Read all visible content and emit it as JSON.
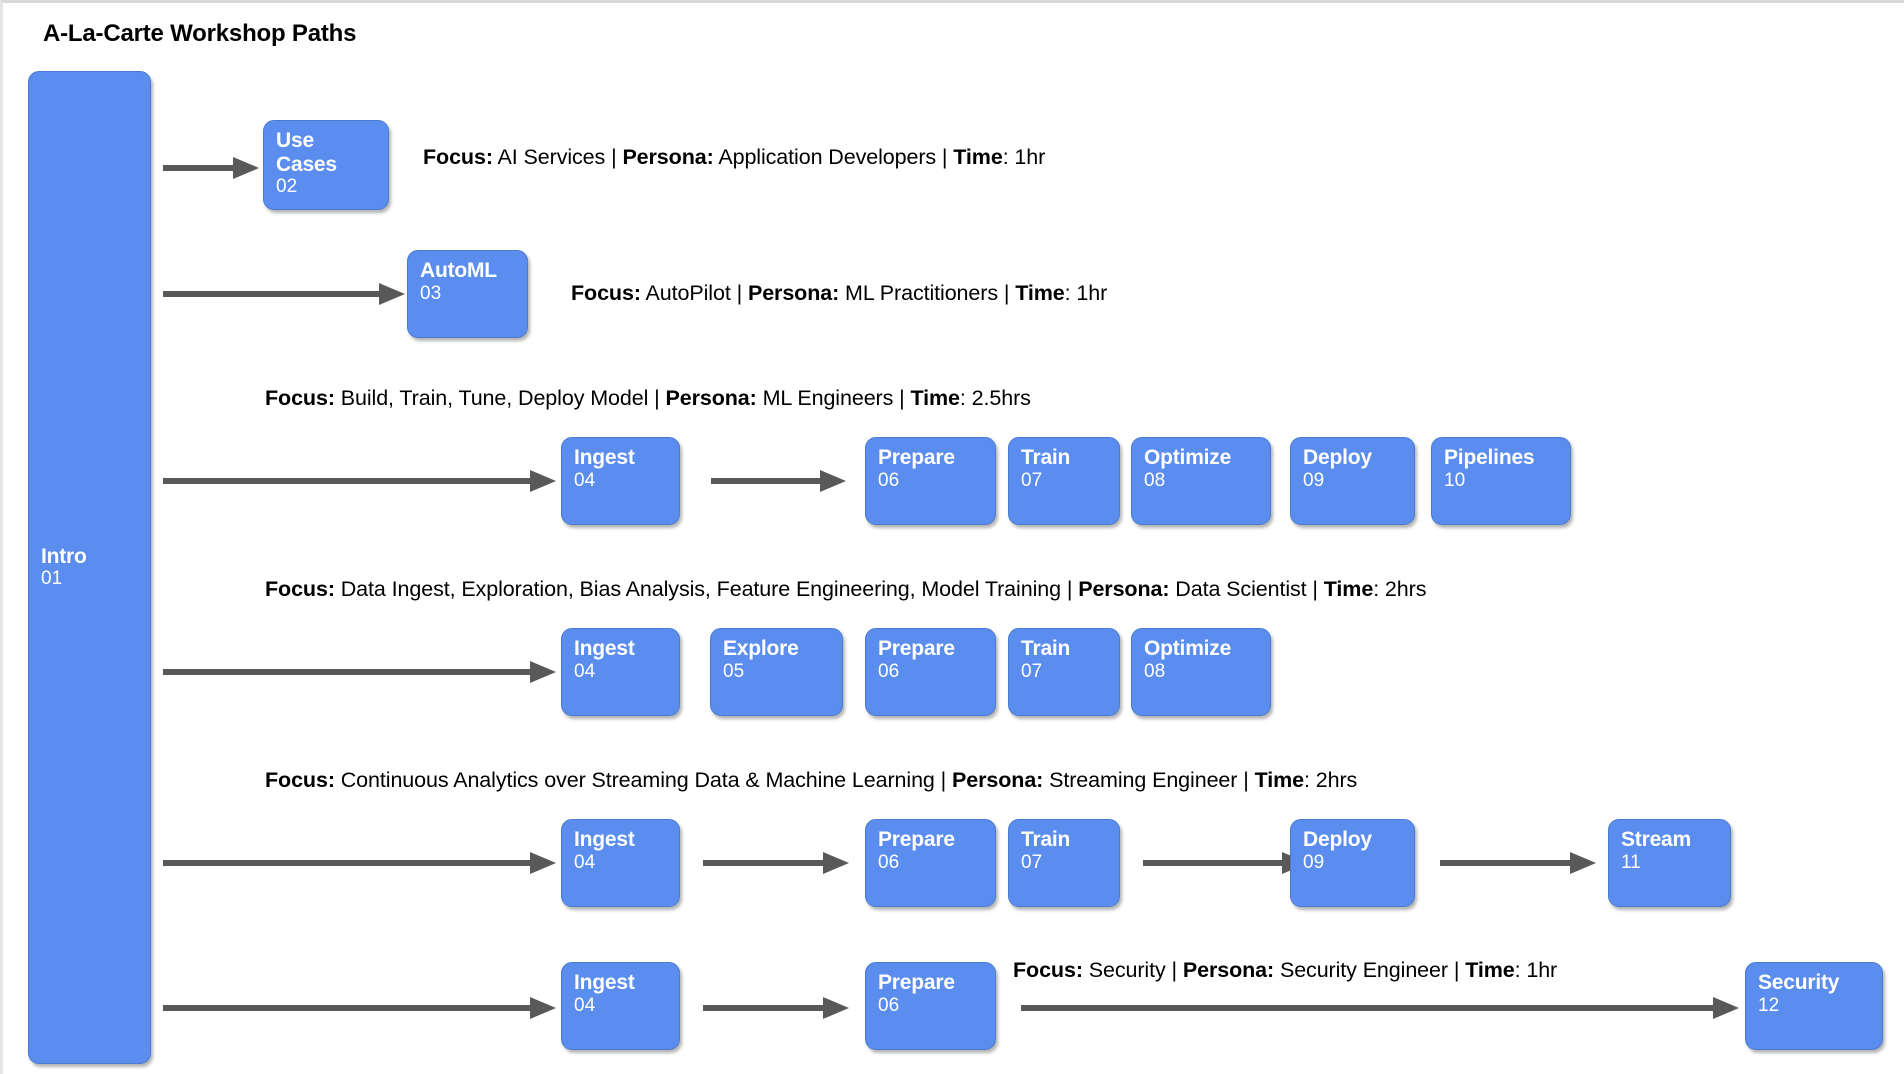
{
  "title": "A-La-Carte Workshop Paths",
  "theme": {
    "node_fill": "#5b8def",
    "node_border": "#4a7bd0",
    "node_text": "#ffffff",
    "arrow_color": "#595959",
    "background": "#ffffff",
    "caption_text": "#000000"
  },
  "intro": {
    "label": "Intro",
    "num": "01"
  },
  "rows": [
    {
      "id": "use-cases",
      "caption": {
        "focus_label": "Focus:",
        "focus": " AI Services | ",
        "persona_label": "Persona:",
        "persona": " Application Developers | ",
        "time_label": "Time",
        "time": ": 1hr"
      },
      "nodes": [
        {
          "label": "Use Cases",
          "line1": "Use",
          "line2": "Cases",
          "num": "02"
        }
      ]
    },
    {
      "id": "automl",
      "caption": {
        "focus_label": "Focus:",
        "focus": " AutoPilot | ",
        "persona_label": "Persona:",
        "persona": " ML Practitioners | ",
        "time_label": "Time",
        "time": ": 1hr"
      },
      "nodes": [
        {
          "label": "AutoML",
          "num": "03"
        }
      ]
    },
    {
      "id": "ml-engineers",
      "caption": {
        "focus_label": "Focus:",
        "focus": " Build, Train, Tune, Deploy Model  | ",
        "persona_label": "Persona:",
        "persona": " ML Engineers | ",
        "time_label": "Time",
        "time": ": 2.5hrs"
      },
      "nodes": [
        {
          "label": "Ingest",
          "num": "04"
        },
        {
          "label": "Prepare",
          "num": "06"
        },
        {
          "label": "Train",
          "num": "07"
        },
        {
          "label": "Optimize",
          "num": "08"
        },
        {
          "label": "Deploy",
          "num": "09"
        },
        {
          "label": "Pipelines",
          "num": "10"
        }
      ]
    },
    {
      "id": "data-scientist",
      "caption": {
        "focus_label": "Focus:",
        "focus": " Data Ingest, Exploration, Bias Analysis, Feature Engineering, Model Training  | ",
        "persona_label": "Persona:",
        "persona": " Data Scientist | ",
        "time_label": "Time",
        "time": ": 2hrs"
      },
      "nodes": [
        {
          "label": "Ingest",
          "num": "04"
        },
        {
          "label": "Explore",
          "num": "05"
        },
        {
          "label": "Prepare",
          "num": "06"
        },
        {
          "label": "Train",
          "num": "07"
        },
        {
          "label": "Optimize",
          "num": "08"
        }
      ]
    },
    {
      "id": "streaming-engineer",
      "caption": {
        "focus_label": "Focus:",
        "focus": " Continuous Analytics over Streaming Data & Machine Learning | ",
        "persona_label": "Persona:",
        "persona": " Streaming Engineer | ",
        "time_label": "Time",
        "time": ": 2hrs"
      },
      "nodes": [
        {
          "label": "Ingest",
          "num": "04"
        },
        {
          "label": "Prepare",
          "num": "06"
        },
        {
          "label": "Train",
          "num": "07"
        },
        {
          "label": "Deploy",
          "num": "09"
        },
        {
          "label": "Stream",
          "num": "11"
        }
      ]
    },
    {
      "id": "security-engineer",
      "caption": {
        "focus_label": "Focus:",
        "focus": " Security | ",
        "persona_label": "Persona:",
        "persona": " Security Engineer | ",
        "time_label": "Time",
        "time": ": 1hr"
      },
      "nodes": [
        {
          "label": "Ingest",
          "num": "04"
        },
        {
          "label": "Prepare",
          "num": "06"
        },
        {
          "label": "Security",
          "num": "12"
        }
      ]
    }
  ]
}
